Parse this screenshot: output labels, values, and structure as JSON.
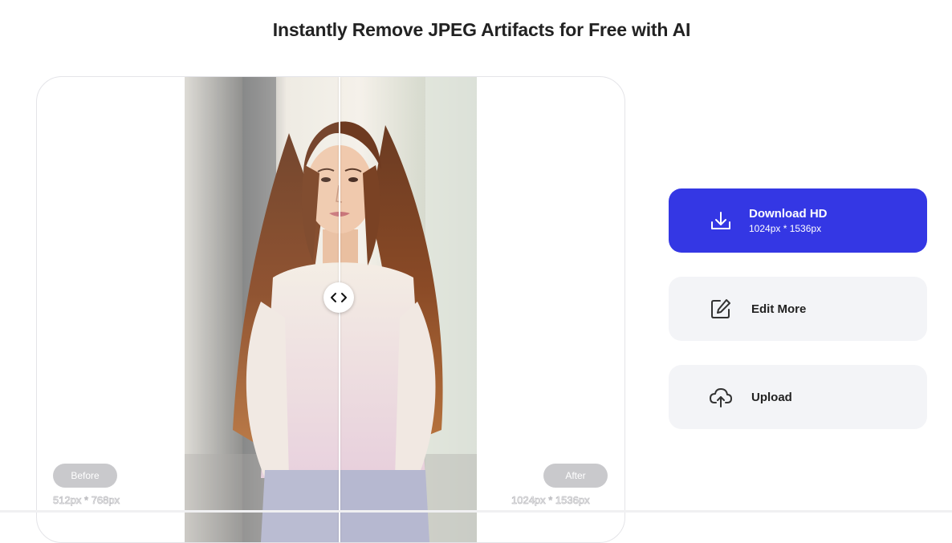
{
  "page": {
    "title": "Instantly Remove JPEG Artifacts for Free with AI"
  },
  "comparison": {
    "before_label": "Before",
    "before_dims": "512px * 768px",
    "after_label": "After",
    "after_dims": "1024px * 1536px",
    "divider_position": 0.53
  },
  "actions": {
    "download": {
      "label": "Download HD",
      "sub": "1024px * 1536px",
      "icon": "download-icon",
      "color": "#3437e4"
    },
    "edit": {
      "label": "Edit More",
      "icon": "edit-icon"
    },
    "upload": {
      "label": "Upload",
      "icon": "cloud-upload-icon"
    }
  },
  "colors": {
    "accent": "#3437e4",
    "secondary_button": "#f3f4f7",
    "pill": "#c9c9cc"
  }
}
